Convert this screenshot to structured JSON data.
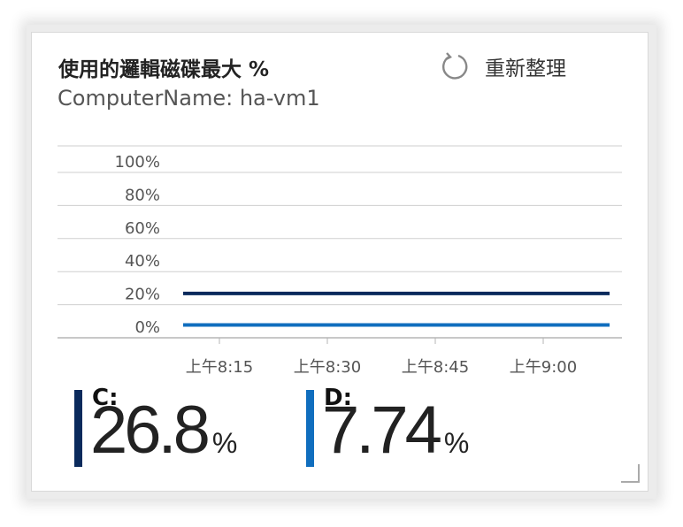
{
  "card": {
    "title": "使用的邏輯磁碟最大 %",
    "subtitle": "ComputerName: ha-vm1",
    "refresh_label": "重新整理"
  },
  "chart_data": {
    "type": "line",
    "y_ticks": [
      "100%",
      "80%",
      "60%",
      "40%",
      "20%",
      "0%"
    ],
    "x_ticks": [
      "上午8:15",
      "上午8:30",
      "上午8:45",
      "上午9:00"
    ],
    "ylim": [
      0,
      100
    ],
    "series": [
      {
        "name": "C:",
        "color": "#0a2a5c",
        "values": [
          26.8,
          26.8
        ]
      },
      {
        "name": "D:",
        "color": "#106ebe",
        "values": [
          7.74,
          7.74
        ]
      }
    ]
  },
  "tiles": [
    {
      "label": "C:",
      "value": "26.8",
      "unit": "%",
      "color": "#0a2a5c"
    },
    {
      "label": "D:",
      "value": "7.74",
      "unit": "%",
      "color": "#106ebe"
    }
  ]
}
